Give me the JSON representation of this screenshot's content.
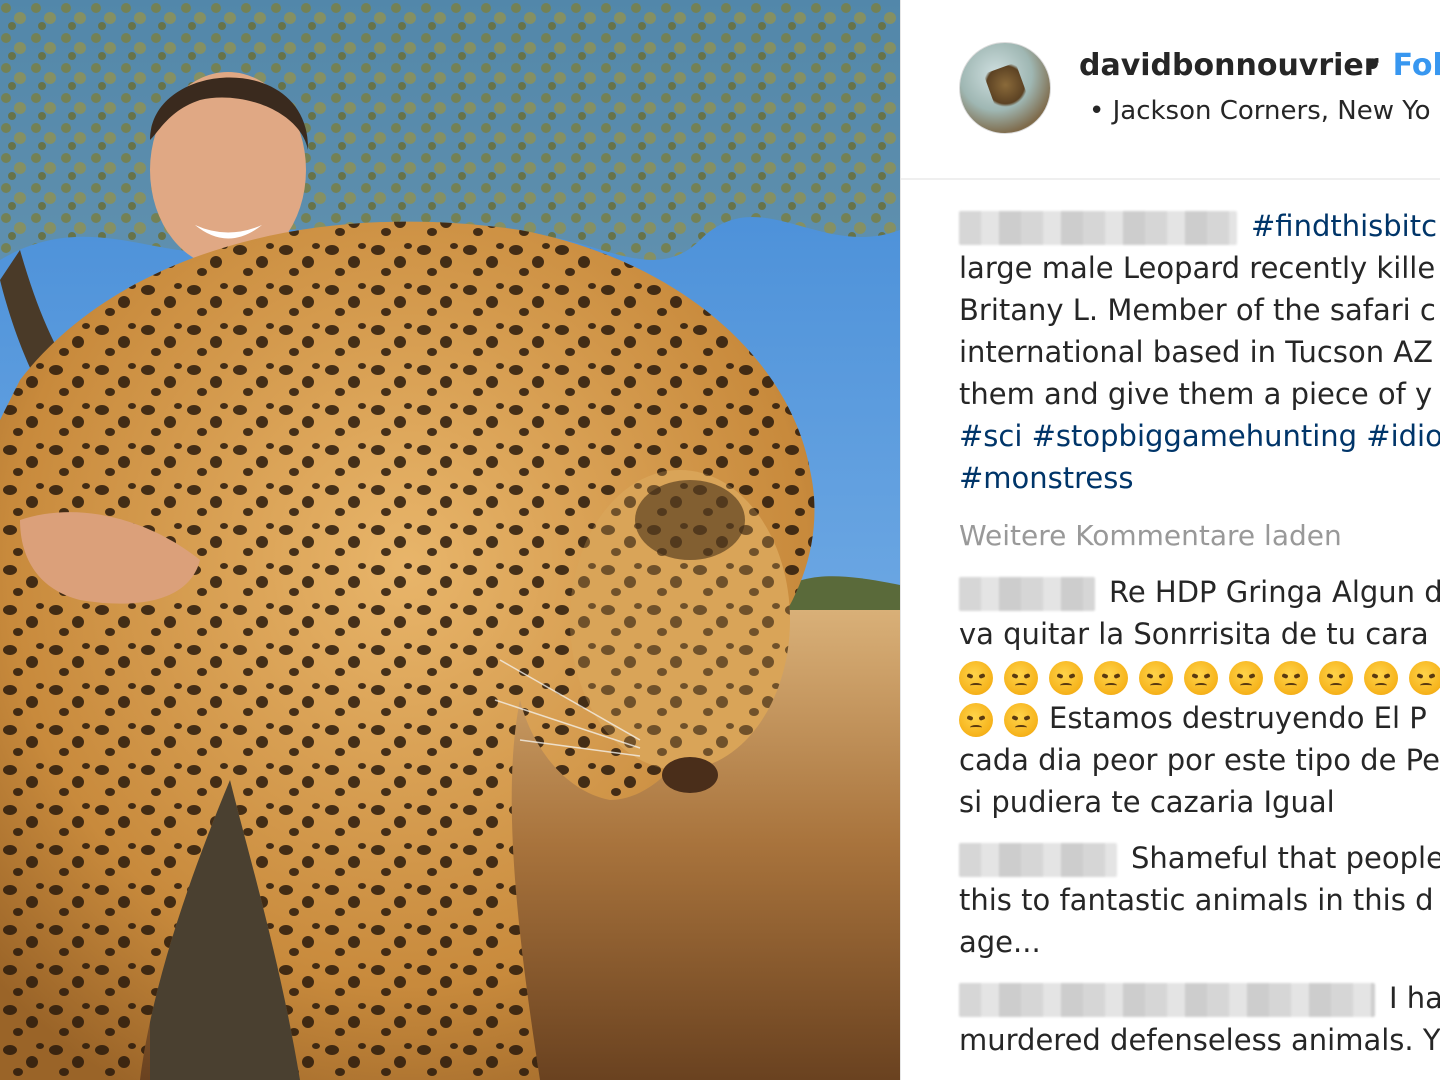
{
  "post": {
    "username": "davidbonnouvrier",
    "separator": "•",
    "follow_label": "Fol",
    "location": "• Jackson Corners, New Yo"
  },
  "caption": {
    "hashtag_first": "#findthisbitc",
    "lines": [
      "large male Leopard recently kille",
      "Britany L. Member of the safari c",
      "international based in Tucson AZ",
      "them and give them a piece of y"
    ],
    "hashtag_line": "#sci #stopbiggamehunting #idio",
    "hashtag_last": "#monstress"
  },
  "load_more_label": "Weitere Kommentare laden",
  "comments": [
    {
      "first": "Re HDP Gringa Algun d",
      "lines": [
        "va quitar la Sonrrisita de tu cara"
      ],
      "emoji_row_1_count": 11,
      "emoji_row_2_count": 2,
      "after_emoji": "Estamos destruyendo El P",
      "more_lines": [
        "cada dia peor por este tipo de Pe",
        "si pudiera te cazaria Igual"
      ]
    },
    {
      "first": "Shameful that people",
      "lines": [
        "this to fantastic animals in this d",
        "age..."
      ]
    },
    {
      "first": "I ha",
      "lines": [
        "murdered defenseless animals. Y"
      ]
    }
  ],
  "icons": {
    "avatar": "profile-avatar",
    "emoji": "angry-face-emoji"
  },
  "colors": {
    "link_blue": "#3897f0",
    "hashtag": "#003569",
    "text": "#262626",
    "muted": "#999999"
  }
}
